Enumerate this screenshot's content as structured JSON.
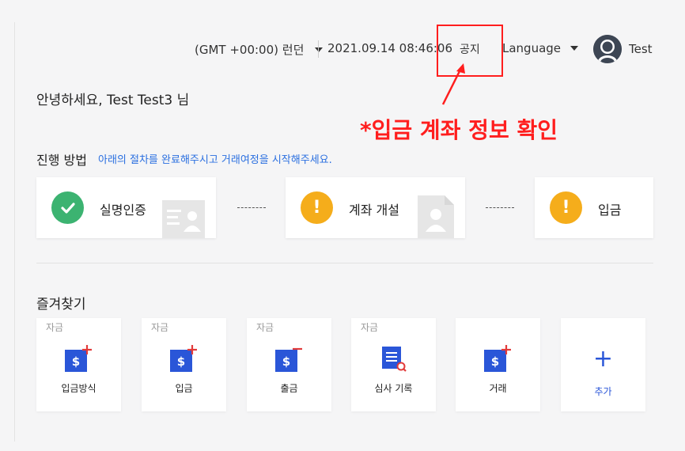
{
  "header": {
    "timezone": "(GMT +00:00) 런던",
    "datetime": "2021.09.14 08:46:06",
    "notice": "공지",
    "language": "Language",
    "username": "Test"
  },
  "annotation": {
    "text": "*입금 계좌 정보 확인",
    "color": "#ff1e1e"
  },
  "greeting": "안녕하세요, Test Test3 님",
  "steps": {
    "title": "진행 방법",
    "description": "아래의 절차를 완료해주시고 거래여정을 시작해주세요.",
    "items": [
      {
        "label": "실명인증",
        "status": "done",
        "icon": "check-icon",
        "color": "#3cb371"
      },
      {
        "label": "계좌 개설",
        "status": "pending",
        "icon": "exclamation-icon",
        "color": "#f5ad1b"
      },
      {
        "label": "입금",
        "status": "pending",
        "icon": "exclamation-icon",
        "color": "#f5ad1b"
      }
    ]
  },
  "favorites": {
    "title": "즐겨찾기",
    "items": [
      {
        "tag": "자금",
        "label": "입금방식",
        "icon": "dollar-plus-icon"
      },
      {
        "tag": "자금",
        "label": "입금",
        "icon": "dollar-plus-icon"
      },
      {
        "tag": "자금",
        "label": "출금",
        "icon": "dollar-minus-icon"
      },
      {
        "tag": "자금",
        "label": "심사 기록",
        "icon": "document-search-icon"
      },
      {
        "tag": "",
        "label": "거래",
        "icon": "dollar-plus-icon"
      }
    ],
    "add": {
      "symbol": "+",
      "label": "추가"
    }
  },
  "colors": {
    "accent": "#2a56d8",
    "link": "#2a6fe0",
    "highlight": "#ff1e1e"
  }
}
